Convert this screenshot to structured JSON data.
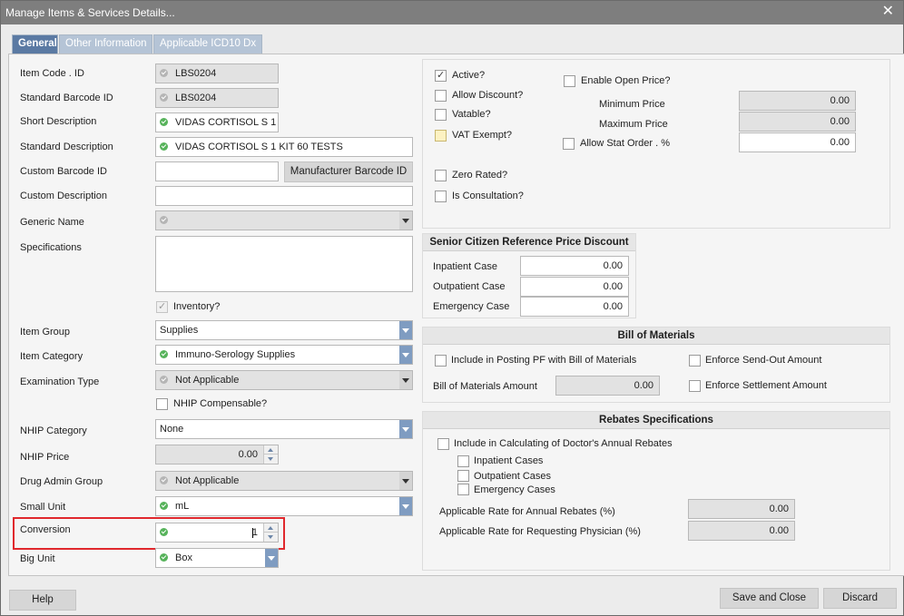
{
  "window": {
    "title": "Manage Items & Services Details...",
    "close_glyph": "✕"
  },
  "tabs": [
    {
      "label": "General",
      "active": true
    },
    {
      "label": "Other Information",
      "active": false
    },
    {
      "label": "Applicable ICD10 Dx",
      "active": false
    }
  ],
  "left": {
    "item_code": {
      "label": "Item Code . ID",
      "value": "LBS0204"
    },
    "std_barcode": {
      "label": "Standard Barcode ID",
      "value": "LBS0204"
    },
    "short_desc": {
      "label": "Short Description",
      "value": "VIDAS CORTISOL S 1"
    },
    "std_desc": {
      "label": "Standard Description",
      "value": "VIDAS CORTISOL S 1 KIT 60 TESTS"
    },
    "custom_barcode": {
      "label": "Custom Barcode ID",
      "value": "",
      "button": "Manufacturer Barcode ID"
    },
    "custom_desc": {
      "label": "Custom Description",
      "value": ""
    },
    "generic_name": {
      "label": "Generic Name",
      "value": ""
    },
    "specifications": {
      "label": "Specifications",
      "value": ""
    },
    "inventory": {
      "label": "Inventory?",
      "checked": true
    },
    "item_group": {
      "label": "Item Group",
      "value": "Supplies"
    },
    "item_category": {
      "label": "Item Category",
      "value": "Immuno-Serology Supplies"
    },
    "exam_type": {
      "label": "Examination Type",
      "value": "Not Applicable"
    },
    "nhip_compensable": {
      "label": "NHIP Compensable?",
      "checked": false
    },
    "nhip_category": {
      "label": "NHIP Category",
      "value": "None"
    },
    "nhip_price": {
      "label": "NHIP Price",
      "value": "0.00"
    },
    "drug_admin_group": {
      "label": "Drug Admin Group",
      "value": "Not Applicable"
    },
    "small_unit": {
      "label": "Small Unit",
      "value": "mL"
    },
    "conversion": {
      "label": "Conversion",
      "value": "1"
    },
    "big_unit": {
      "label": "Big Unit",
      "value": "Box"
    }
  },
  "flags": {
    "active": {
      "label": "Active?",
      "checked": true
    },
    "allow_discount": {
      "label": "Allow Discount?",
      "checked": false
    },
    "vatable": {
      "label": "Vatable?",
      "checked": false
    },
    "vat_exempt": {
      "label": "VAT Exempt?",
      "checked": false
    },
    "zero_rated": {
      "label": "Zero Rated?",
      "checked": false
    },
    "is_consultation": {
      "label": "Is Consultation?",
      "checked": false
    },
    "enable_open_price": {
      "label": "Enable Open Price?",
      "checked": false
    },
    "min_price": {
      "label": "Minimum Price",
      "value": "0.00"
    },
    "max_price": {
      "label": "Maximum Price",
      "value": "0.00"
    },
    "allow_stat_order": {
      "label": "Allow Stat Order . %",
      "checked": false,
      "value": "0.00"
    }
  },
  "senior": {
    "title": "Senior Citizen Reference Price Discount",
    "inpatient": {
      "label": "Inpatient Case",
      "value": "0.00"
    },
    "outpatient": {
      "label": "Outpatient Case",
      "value": "0.00"
    },
    "emergency": {
      "label": "Emergency Case",
      "value": "0.00"
    }
  },
  "bom": {
    "title": "Bill of Materials",
    "include_posting": {
      "label": "Include in Posting PF with Bill of Materials",
      "checked": false
    },
    "enforce_sendout": {
      "label": "Enforce Send-Out Amount",
      "checked": false
    },
    "amount": {
      "label": "Bill of Materials Amount",
      "value": "0.00"
    },
    "enforce_settlement": {
      "label": "Enforce Settlement Amount",
      "checked": false
    }
  },
  "rebates": {
    "title": "Rebates Specifications",
    "include_calc": {
      "label": "Include in Calculating of Doctor's Annual Rebates",
      "checked": false
    },
    "inpatient": {
      "label": "Inpatient Cases",
      "checked": false
    },
    "outpatient": {
      "label": "Outpatient Cases",
      "checked": false
    },
    "emergency": {
      "label": "Emergency Cases",
      "checked": false
    },
    "annual_rate": {
      "label": "Applicable Rate for Annual Rebates (%)",
      "value": "0.00"
    },
    "physician_rate": {
      "label": "Applicable Rate for Requesting Physician (%)",
      "value": "0.00"
    }
  },
  "footer": {
    "help": "Help",
    "save_close": "Save and Close",
    "discard": "Discard"
  },
  "colors": {
    "titlebar": "#7e7e7e",
    "tab_active": "#5b7aa3",
    "tab_inactive": "#b5c4d6",
    "dropdown": "#7f9cc1",
    "valid": "#57b35b",
    "highlight": "#e0282d"
  }
}
